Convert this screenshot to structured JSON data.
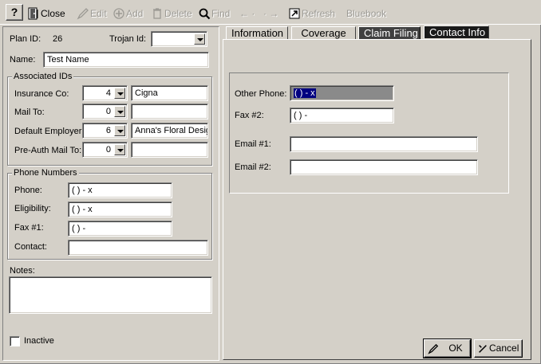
{
  "toolbar": {
    "help": "?",
    "close": "Close",
    "edit": "Edit",
    "add": "Add",
    "delete": "Delete",
    "find": "Find",
    "prev": "← ·",
    "next": "· →",
    "refresh": "Refresh",
    "bluebook": "Bluebook"
  },
  "plan": {
    "plan_id_label": "Plan ID:",
    "plan_id_value": "26",
    "trojan_id_label": "Trojan Id:",
    "trojan_id_value": "",
    "name_label": "Name:",
    "name_value": "Test Name"
  },
  "associated": {
    "title": "Associated IDs",
    "insurance_label": "Insurance Co:",
    "insurance_num": "4",
    "insurance_name": "Cigna",
    "mailto_label": "Mail To:",
    "mailto_num": "0",
    "mailto_name": "",
    "employer_label": "Default Employer:",
    "employer_num": "6",
    "employer_name": "Anna's Floral Design",
    "preauth_label": "Pre-Auth Mail To:",
    "preauth_num": "0",
    "preauth_name": ""
  },
  "phones": {
    "title": "Phone Numbers",
    "phone_label": "Phone:",
    "phone_value": "(  )   -      x",
    "eligibility_label": "Eligibility:",
    "eligibility_value": "(  )   -      x",
    "fax1_label": "Fax #1:",
    "fax1_value": "(  )   -",
    "contact_label": "Contact:",
    "contact_value": ""
  },
  "notes": {
    "label": "Notes:",
    "value": ""
  },
  "inactive": {
    "label": "Inactive",
    "checked": false
  },
  "tabs": [
    {
      "label": "Information"
    },
    {
      "label": "Coverage"
    },
    {
      "label": "Claim Filing"
    },
    {
      "label": "Contact Info"
    }
  ],
  "contact": {
    "other_phone_label": "Other Phone:",
    "other_phone_value": "(  )   -      x",
    "fax2_label": "Fax #2:",
    "fax2_value": "(  )   -",
    "email1_label": "Email #1:",
    "email1_value": "",
    "email2_label": "Email #2:",
    "email2_value": ""
  },
  "buttons": {
    "ok": "OK",
    "cancel": "Cancel"
  }
}
